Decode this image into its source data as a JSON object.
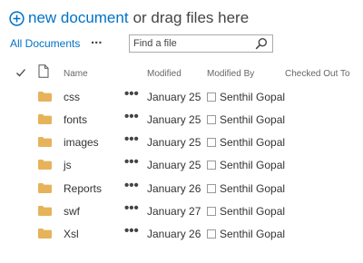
{
  "command_bar": {
    "new_document_label": "new document",
    "drag_text": "or drag files here"
  },
  "view": {
    "current_view": "All Documents",
    "more_label": "..."
  },
  "search": {
    "placeholder": "Find a file"
  },
  "columns": {
    "name": "Name",
    "modified": "Modified",
    "modified_by": "Modified By",
    "checked_out_to": "Checked Out To"
  },
  "rows": [
    {
      "name": "css",
      "modified": "January 25",
      "modified_by": "Senthil Gopal"
    },
    {
      "name": "fonts",
      "modified": "January 25",
      "modified_by": "Senthil Gopal"
    },
    {
      "name": "images",
      "modified": "January 25",
      "modified_by": "Senthil Gopal"
    },
    {
      "name": "js",
      "modified": "January 25",
      "modified_by": "Senthil Gopal"
    },
    {
      "name": "Reports",
      "modified": "January 26",
      "modified_by": "Senthil Gopal"
    },
    {
      "name": "swf",
      "modified": "January 27",
      "modified_by": "Senthil Gopal"
    },
    {
      "name": "Xsl",
      "modified": "January 26",
      "modified_by": "Senthil Gopal"
    }
  ],
  "row_more_label": "•••",
  "colors": {
    "accent": "#0072c6",
    "folder": "#e6b35a"
  }
}
